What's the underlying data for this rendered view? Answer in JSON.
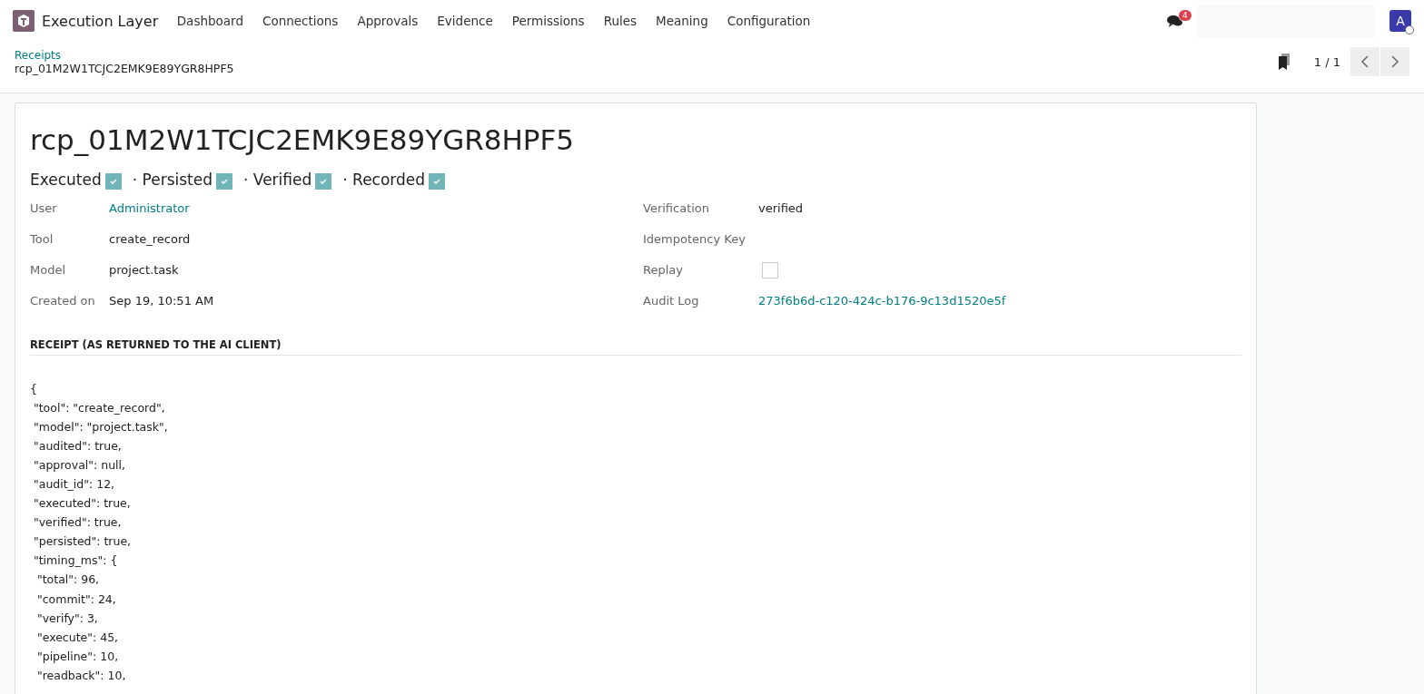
{
  "navbar": {
    "app_name": "Execution Layer",
    "menu": [
      {
        "label": "Dashboard"
      },
      {
        "label": "Connections"
      },
      {
        "label": "Approvals"
      },
      {
        "label": "Evidence"
      },
      {
        "label": "Permissions"
      },
      {
        "label": "Rules"
      },
      {
        "label": "Meaning"
      },
      {
        "label": "Configuration"
      }
    ],
    "messages_count": "4",
    "avatar_letter": "A"
  },
  "control_panel": {
    "breadcrumb": "Receipts",
    "record_name": "rcp_01M2W1TCJC2EMK9E89YGR8HPF5",
    "pager": "1 / 1"
  },
  "record": {
    "title": "rcp_01M2W1TCJC2EMK9E89YGR8HPF5",
    "flags": [
      {
        "label": "Executed",
        "checked": true
      },
      {
        "label": "· Persisted",
        "checked": true
      },
      {
        "label": "· Verified",
        "checked": true
      },
      {
        "label": "· Recorded",
        "checked": true
      }
    ],
    "left_fields": [
      {
        "label": "User",
        "value": "Administrator",
        "kind": "link"
      },
      {
        "label": "Tool",
        "value": "create_record",
        "kind": "text"
      },
      {
        "label": "Model",
        "value": "project.task",
        "kind": "text"
      },
      {
        "label": "Created on",
        "value": "Sep 19, 10:51 AM",
        "kind": "text"
      }
    ],
    "right_fields": [
      {
        "label": "Verification",
        "value": "verified",
        "kind": "text"
      },
      {
        "label": "Idempotency Key",
        "kind": "text"
      },
      {
        "label": "Replay",
        "kind": "checkbox",
        "checked": false
      },
      {
        "label": "Audit Log",
        "value": "273f6b6d-c120-424c-b176-9c13d1520e5f",
        "kind": "link"
      }
    ],
    "section_title": "RECEIPT (AS RETURNED TO THE AI CLIENT)",
    "receipt_lines": [
      "{",
      " \"tool\": \"create_record\",",
      " \"model\": \"project.task\",",
      " \"audited\": true,",
      " \"approval\": null,",
      " \"audit_id\": 12,",
      " \"executed\": true,",
      " \"verified\": true,",
      " \"persisted\": true,",
      " \"timing_ms\": {",
      "  \"total\": 96,",
      "  \"commit\": 24,",
      "  \"verify\": 3,",
      "  \"execute\": 45,",
      "  \"pipeline\": 10,",
      "  \"readback\": 10,"
    ]
  }
}
